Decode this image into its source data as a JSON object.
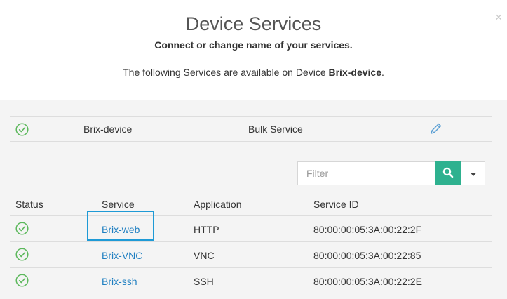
{
  "header": {
    "title": "Device Services",
    "subtitle": "Connect or change name of your services.",
    "available_prefix": "The following Services are available on Device ",
    "device_name": "Brix-device",
    "available_suffix": ".",
    "close_label": "×"
  },
  "device": {
    "name": "Brix-device",
    "type": "Bulk Service",
    "status_icon": "check-circle-icon",
    "edit_icon": "pencil-icon"
  },
  "filter": {
    "placeholder": "Filter"
  },
  "table": {
    "headers": {
      "status": "Status",
      "service": "Service",
      "application": "Application",
      "service_id": "Service ID"
    },
    "rows": [
      {
        "service": "Brix-web",
        "application": "HTTP",
        "service_id": "80:00:00:05:3A:00:22:2F"
      },
      {
        "service": "Brix-VNC",
        "application": "VNC",
        "service_id": "80:00:00:05:3A:00:22:85"
      },
      {
        "service": "Brix-ssh",
        "application": "SSH",
        "service_id": "80:00:00:05:3A:00:22:2E"
      }
    ]
  },
  "colors": {
    "accent": "#2eb18f",
    "link": "#1f7fc1",
    "highlight": "#1e9ad6",
    "status_ok": "#5cb85c"
  }
}
